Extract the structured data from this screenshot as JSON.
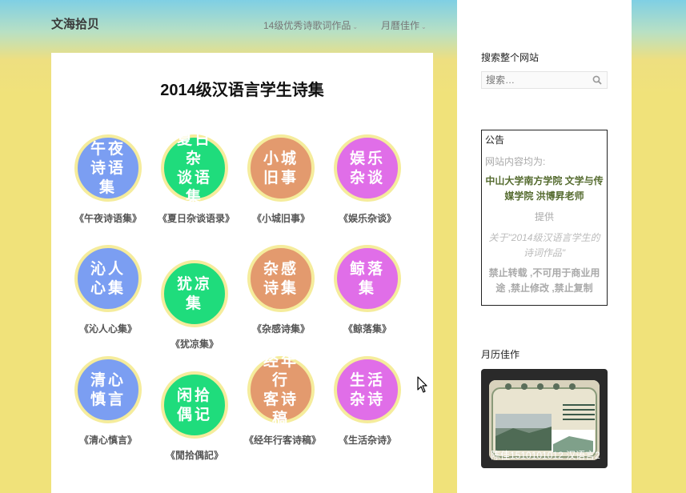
{
  "header": {
    "site_title": "文海拾贝",
    "nav": [
      {
        "label": "14级优秀诗歌词作品"
      },
      {
        "label": "月曆佳作"
      }
    ]
  },
  "main": {
    "title": "2014级汉语言学生诗集",
    "gallery": [
      {
        "badge": "午夜\n诗语集",
        "caption": "《午夜诗语集》",
        "color": "#7b9ef2"
      },
      {
        "badge": "夏日杂\n谈语集",
        "caption": "《夏日杂谈语录》",
        "color": "#1fdc7c"
      },
      {
        "badge": "小城\n旧事",
        "caption": "《小城旧事》",
        "color": "#e39a6e"
      },
      {
        "badge": "娱乐\n杂谈",
        "caption": "《娱乐杂谈》",
        "color": "#e06ee8"
      },
      {
        "badge": "沁人\n心集",
        "caption": "《沁人心集》",
        "color": "#7b9ef2"
      },
      {
        "badge": "犹凉\n集",
        "caption": "《犹凉集》",
        "color": "#1fdc7c"
      },
      {
        "badge": "杂感\n诗集",
        "caption": "《杂感诗集》",
        "color": "#e39a6e"
      },
      {
        "badge": "鲸落\n集",
        "caption": "《鲸落集》",
        "color": "#e06ee8"
      },
      {
        "badge": "清心\n慎言",
        "caption": "《清心慎言》",
        "color": "#7b9ef2"
      },
      {
        "badge": "闲拾\n偶记",
        "caption": "《閒拾偶記》",
        "color": "#1fdc7c"
      },
      {
        "badge": "经年行\n客诗稿",
        "caption": "《经年行客诗稿》",
        "color": "#e39a6e"
      },
      {
        "badge": "生活\n杂诗",
        "caption": "《生活杂诗》",
        "color": "#e06ee8"
      }
    ]
  },
  "sidebar": {
    "search_title": "搜索整个网站",
    "search_placeholder": "搜索…",
    "notice": {
      "title": "公告",
      "line1": "网站内容均为:",
      "line2": "中山大学南方学院 文学与传媒学院 洪博昇老师",
      "line3": "提供",
      "line4": "关于\"2014级汉语言学生的诗词作品\"",
      "line5": "禁止转载 ,不可用于商业用途 ,禁止修改 ,禁止复制"
    },
    "calendar_title": "月历佳作",
    "calendar_caption": "陈佳1510101012 汉语言2"
  }
}
